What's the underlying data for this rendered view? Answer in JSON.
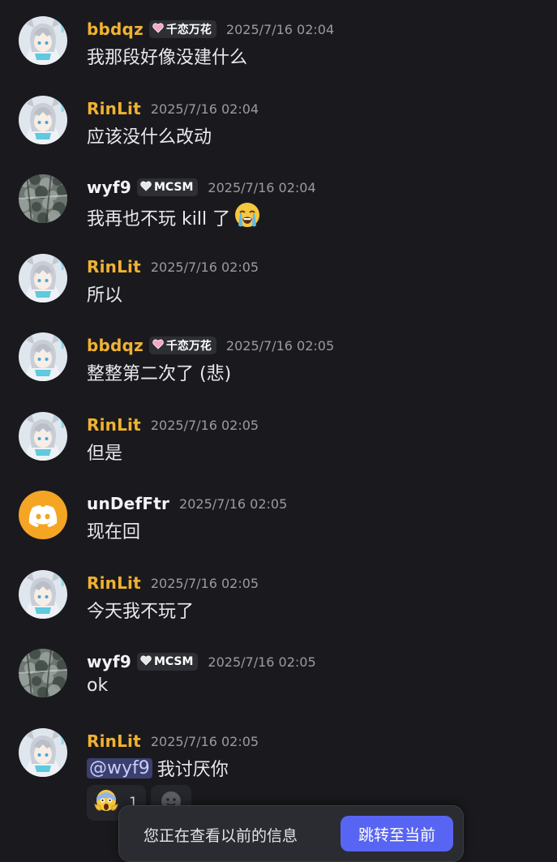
{
  "colors": {
    "background": "#1a1a1e",
    "username_gold": "#f0b232",
    "username_white": "#f2f3f5",
    "timestamp": "#9a9ba2",
    "accent": "#5865f2",
    "mention_bg": "#3b3f6e",
    "discord_orange": "#f5a524"
  },
  "messages": [
    {
      "author": "bbdqz",
      "author_color": "gold",
      "tag": "千恋万花",
      "tag_icon": "pink-heart-icon",
      "time": "2025/7/16 02:04",
      "text": "我那段好像没建什么",
      "avatar": "anime-avatar"
    },
    {
      "author": "RinLit",
      "author_color": "gold",
      "tag": "",
      "time": "2025/7/16 02:04",
      "text": "应该没什么改动",
      "avatar": "anime-avatar"
    },
    {
      "author": "wyf9",
      "author_color": "white",
      "tag": "MCSM",
      "tag_icon": "white-heart-icon",
      "time": "2025/7/16 02:04",
      "text": "我再也不玩 kill 了",
      "emoji": "loudly-crying-face-icon",
      "avatar": "tree-photo-avatar"
    },
    {
      "author": "RinLit",
      "author_color": "gold",
      "tag": "",
      "time": "2025/7/16 02:05",
      "text": "所以",
      "avatar": "anime-avatar"
    },
    {
      "author": "bbdqz",
      "author_color": "gold",
      "tag": "千恋万花",
      "tag_icon": "pink-heart-icon",
      "time": "2025/7/16 02:05",
      "text": "整整第二次了 (悲)",
      "avatar": "anime-avatar"
    },
    {
      "author": "RinLit",
      "author_color": "gold",
      "tag": "",
      "time": "2025/7/16 02:05",
      "text": "但是",
      "avatar": "anime-avatar"
    },
    {
      "author": "unDefFtr",
      "author_color": "white",
      "tag": "",
      "time": "2025/7/16 02:05",
      "text": "现在回",
      "avatar": "discord-default-avatar"
    },
    {
      "author": "RinLit",
      "author_color": "gold",
      "tag": "",
      "time": "2025/7/16 02:05",
      "text": "今天我不玩了",
      "avatar": "anime-avatar"
    },
    {
      "author": "wyf9",
      "author_color": "white",
      "tag": "MCSM",
      "tag_icon": "white-heart-icon",
      "time": "2025/7/16 02:05",
      "text": "ok",
      "avatar": "tree-photo-avatar"
    },
    {
      "author": "RinLit",
      "author_color": "gold",
      "tag": "",
      "time": "2025/7/16 02:05",
      "mention": "@wyf9",
      "text": "我讨厌你",
      "avatar": "anime-avatar"
    }
  ],
  "reactions": [
    {
      "emoji": "face-screaming-in-fear-icon",
      "count": "1"
    },
    {
      "emoji": "add-reaction-icon",
      "count": ""
    }
  ],
  "banner": {
    "text": "您正在查看以前的信息",
    "button_label": "跳转至当前"
  }
}
